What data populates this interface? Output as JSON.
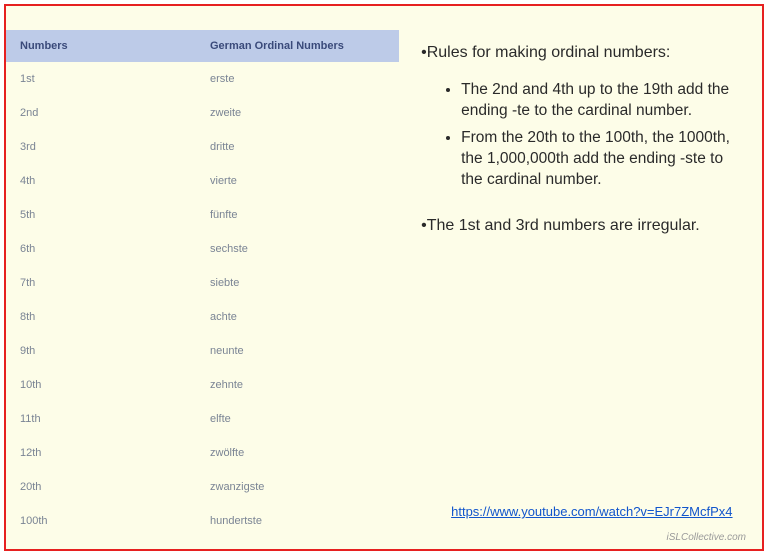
{
  "table": {
    "headers": {
      "col1": "Numbers",
      "col2": "German Ordinal Numbers"
    },
    "rows": [
      {
        "num": "1st",
        "ger": "erste"
      },
      {
        "num": "2nd",
        "ger": "zweite"
      },
      {
        "num": "3rd",
        "ger": "dritte"
      },
      {
        "num": "4th",
        "ger": "vierte"
      },
      {
        "num": "5th",
        "ger": "fünfte"
      },
      {
        "num": "6th",
        "ger": "sechste"
      },
      {
        "num": "7th",
        "ger": "siebte"
      },
      {
        "num": "8th",
        "ger": "achte"
      },
      {
        "num": "9th",
        "ger": "neunte"
      },
      {
        "num": "10th",
        "ger": "zehnte"
      },
      {
        "num": "11th",
        "ger": "elfte"
      },
      {
        "num": "12th",
        "ger": "zwölfte"
      },
      {
        "num": "20th",
        "ger": "zwanzigste"
      },
      {
        "num": "100th",
        "ger": "hundertste"
      }
    ]
  },
  "rules": {
    "heading": "•Rules for making ordinal numbers:",
    "items": [
      "The 2nd and 4th up to the 19th add the ending -te to the cardinal number.",
      "From the 20th to the 100th, the 1000th, the 1,000,000th add the ending -ste to the cardinal number."
    ],
    "irregular": "•The 1st and 3rd numbers are irregular."
  },
  "link": {
    "text": "https://www.youtube.com/watch?v=EJr7ZMcfPx4"
  },
  "watermark": "iSLCollective.com"
}
